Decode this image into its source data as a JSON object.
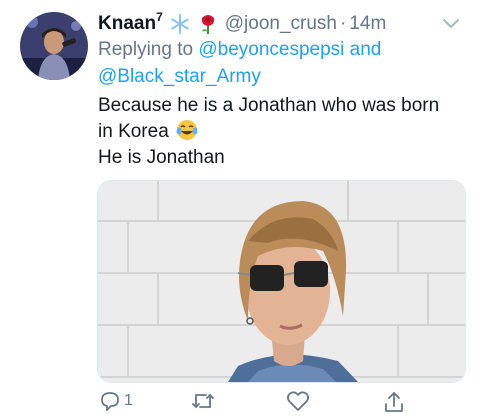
{
  "tweet": {
    "author_name": "Knaan",
    "author_superscript": "7",
    "badge_icons": [
      "snowflake-icon",
      "rose-icon"
    ],
    "handle": "@joon_crush",
    "separator": "·",
    "time": "14m",
    "more_icon": "chevron-down-icon",
    "replying_prefix": "Replying to",
    "reply_to_1": "@beyoncespepsi",
    "reply_joiner": "and",
    "reply_to_2": "@Black_star_Army",
    "text_line_1": "Because he is a Jonathan who was born",
    "text_line_2": "in Korea",
    "text_line_2_emoji": "tears-of-joy-icon",
    "text_line_3": "He is Jonathan"
  },
  "actions": {
    "reply_count": "1",
    "icons": [
      "reply-icon",
      "retweet-icon",
      "like-icon",
      "share-icon"
    ]
  },
  "colors": {
    "text": "#14171a",
    "secondary": "#657786",
    "link": "#1da1f2"
  }
}
